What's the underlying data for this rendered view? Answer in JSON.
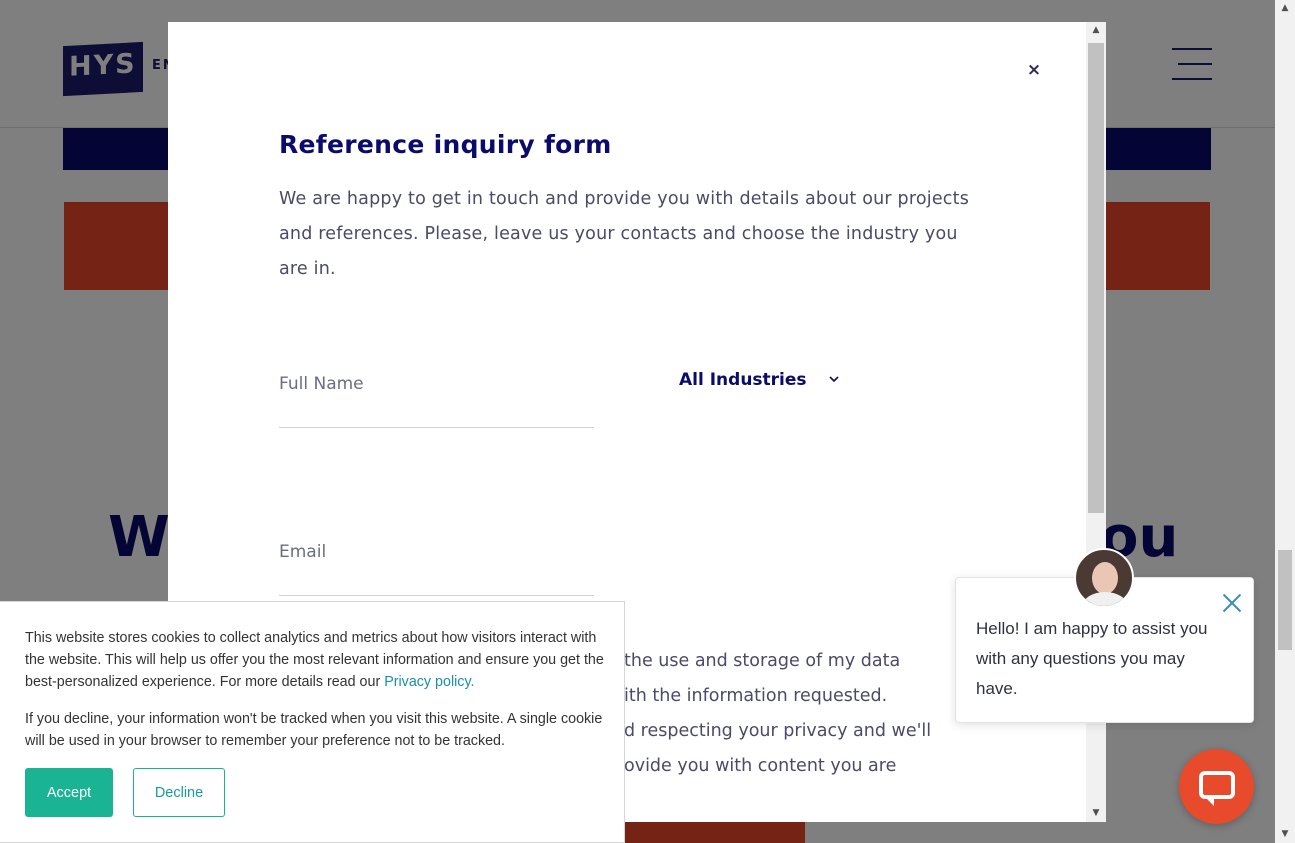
{
  "background": {
    "logo_text": "HYS",
    "logo_suffix": "EN",
    "heading_left": "We",
    "heading_right": "ou"
  },
  "modal": {
    "close_icon": "×",
    "title": "Reference inquiry form",
    "intro": "We are happy to get in touch and provide you with details about our projects and references. Please, leave us your contacts and choose the industry you are in.",
    "full_name_placeholder": "Full Name",
    "industry_selected": "All Industries",
    "email_placeholder": "Email",
    "consent_lines": [
      "the use and storage of my data",
      "ith the information requested.",
      "d respecting your privacy and we'll",
      "ovide you with content you are"
    ]
  },
  "cookie_banner": {
    "text1_before_link": "This website stores cookies to collect analytics and metrics about how visitors interact with the website. This will help us offer you the most relevant information and ensure you get the best-personalized experience. For more details read our ",
    "privacy_link": "Privacy policy.",
    "text2": "If you decline, your information won't be tracked when you visit this website. A single cookie will be used in your browser to remember your preference not to be tracked.",
    "accept_label": "Accept",
    "decline_label": "Decline"
  },
  "chat": {
    "message": "Hello! I am happy to assist you with any questions you may have."
  },
  "colors": {
    "navy": "#0b0b6b",
    "orange": "#e8472a",
    "teal_accept": "#1ab394",
    "chat_close": "#3a8fb7"
  }
}
